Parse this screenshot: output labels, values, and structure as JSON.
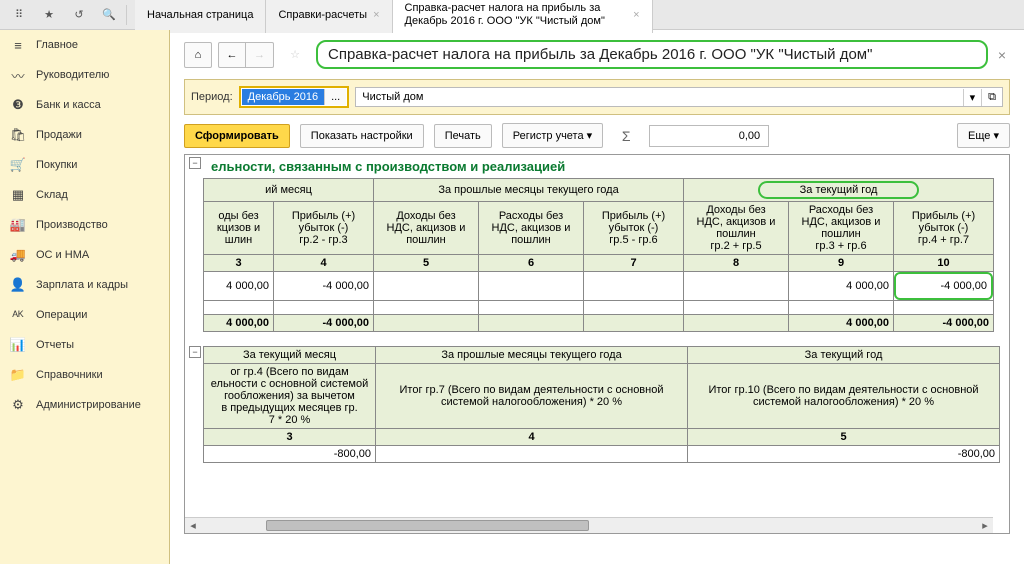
{
  "tabs": {
    "t1": "Начальная страница",
    "t2": "Справки-расчеты",
    "t3": "Справка-расчет налога на прибыль  за Декабрь 2016 г. ООО \"УК \"Чистый дом\""
  },
  "sidebar": {
    "items": [
      {
        "icon": "≡",
        "label": "Главное"
      },
      {
        "icon": "〰",
        "label": "Руководителю"
      },
      {
        "icon": "❸",
        "label": "Банк и касса"
      },
      {
        "icon": "🛍",
        "label": "Продажи"
      },
      {
        "icon": "🛒",
        "label": "Покупки"
      },
      {
        "icon": "▦",
        "label": "Склад"
      },
      {
        "icon": "🏭",
        "label": "Производство"
      },
      {
        "icon": "🚚",
        "label": "ОС и НМА"
      },
      {
        "icon": "👤",
        "label": "Зарплата и кадры"
      },
      {
        "icon": "ᴬᴷ",
        "label": "Операции"
      },
      {
        "icon": "📊",
        "label": "Отчеты"
      },
      {
        "icon": "📁",
        "label": "Справочники"
      },
      {
        "icon": "⚙",
        "label": "Администрирование"
      }
    ]
  },
  "page": {
    "title": "Справка-расчет налога на прибыль  за Декабрь 2016 г. ООО \"УК \"Чистый дом\""
  },
  "params": {
    "period_label": "Период:",
    "period_value": "Декабрь 2016",
    "org_value": "Чистый дом"
  },
  "actions": {
    "form": "Сформировать",
    "settings": "Показать настройки",
    "print": "Печать",
    "register": "Регистр учета",
    "sum": "0,00",
    "more": "Еще"
  },
  "report": {
    "section1_title": "ельности, связанным с производством и реализацией",
    "h_month": "ий месяц",
    "h_prev": "За прошлые месяцы текущего года",
    "h_year": "За текущий год",
    "c1": "оды без\nкцизов и\nшлин",
    "c2": "Прибыль (+)\nубыток (-)\nгр.2 - гр.3",
    "c3": "Доходы без\nНДС, акцизов и\nпошлин",
    "c4": "Расходы без\nНДС, акцизов и\nпошлин",
    "c5": "Прибыль (+)\nубыток (-)\nгр.5 - гр.6",
    "c6": "Доходы без\nНДС, акцизов и\nпошлин\nгр.2 + гр.5",
    "c7": "Расходы без\nНДС, акцизов и\nпошлин\nгр.3 + гр.6",
    "c8": "Прибыль (+)\nубыток (-)\nгр.4 + гр.7",
    "nums": [
      "3",
      "4",
      "5",
      "6",
      "7",
      "8",
      "9",
      "10"
    ],
    "r1": [
      "4 000,00",
      "-4 000,00",
      "",
      "",
      "",
      "",
      "4 000,00",
      "-4 000,00"
    ],
    "tot": [
      "4 000,00",
      "-4 000,00",
      "",
      "",
      "",
      "",
      "4 000,00",
      "-4 000,00"
    ],
    "sec2_h_month": "За текущий месяц",
    "sec2_h_prev": "За прошлые месяцы текущего года",
    "sec2_h_year": "За текущий год",
    "sec2_c1": "ог гр.4 (Всего по видам\nельности с основной системой\nгообложения) за вычетом\nв предыдущих месяцев гр.\n7 * 20 %",
    "sec2_c2": "Итог гр.7 (Всего по видам деятельности с основной\nсистемой налогообложения) * 20 %",
    "sec2_c3": "Итог гр.10 (Всего по видам деятельности с основной\nсистемой налогообложения) * 20 %",
    "sec2_nums": [
      "3",
      "4",
      "5"
    ],
    "sec2_r1": [
      "-800,00",
      "",
      "-800,00"
    ]
  }
}
